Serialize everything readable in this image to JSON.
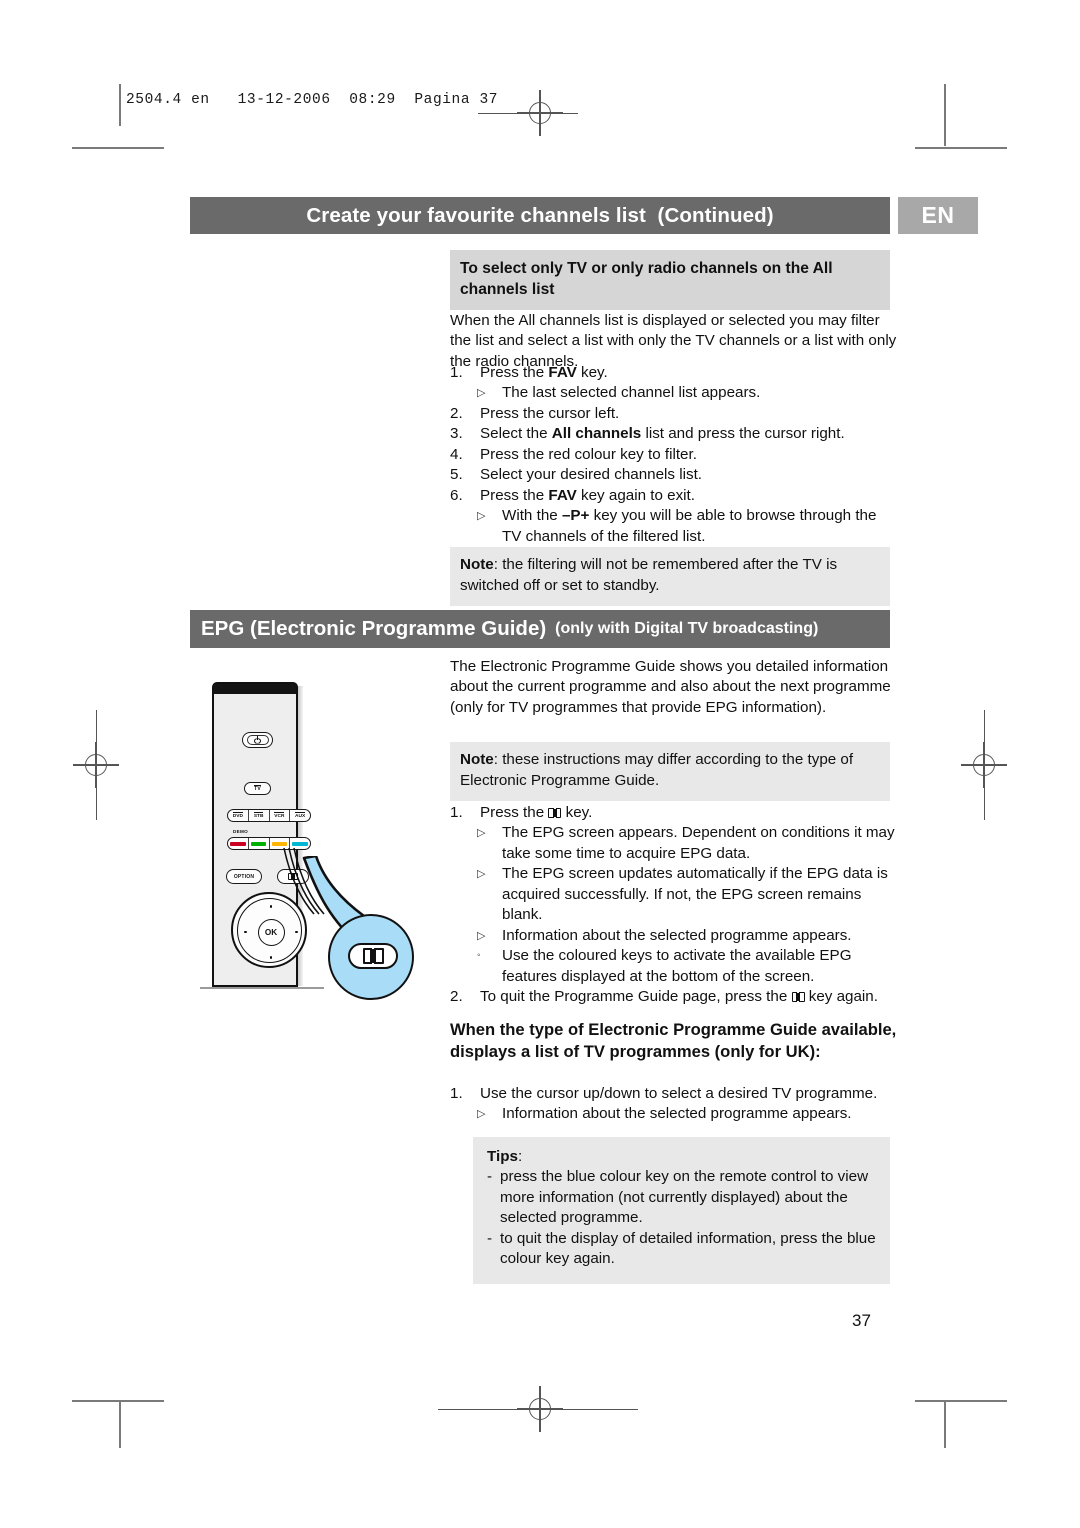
{
  "print_marks": {
    "file_info": "2504.4 en   13-12-2006  08:29  Pagina 37"
  },
  "header": {
    "title_main": "Create your favourite channels list",
    "title_continued": "(Continued)",
    "language_badge": "EN"
  },
  "section_filter": {
    "subheading": "To select only TV or only radio channels on the All channels list",
    "intro": "When the All channels list is displayed or selected you may filter the list and select a list with only the TV channels or a list with only the radio channels.",
    "steps": [
      {
        "num": "1.",
        "text_a": "Press the ",
        "bold": "FAV",
        "text_b": " key."
      },
      {
        "num": "2.",
        "text_a": "Press the cursor left.",
        "bold": "",
        "text_b": ""
      },
      {
        "num": "3.",
        "text_a": "Select the ",
        "bold": "All channels",
        "text_b": " list and press the cursor right."
      },
      {
        "num": "4.",
        "text_a": "Press the red colour key to filter.",
        "bold": "",
        "text_b": ""
      },
      {
        "num": "5.",
        "text_a": "Select your desired channels list.",
        "bold": "",
        "text_b": ""
      },
      {
        "num": "6.",
        "text_a": "Press the ",
        "bold": "FAV",
        "text_b": " key again to exit."
      }
    ],
    "sub_after_step1": "The last selected channel list appears.",
    "sub_after_step6_a": "With the ",
    "sub_after_step6_bold": "–P+",
    "sub_after_step6_b": " key you will be able to browse through the TV channels of the filtered list.",
    "note_label": "Note",
    "note_text": ": the filtering will not be remembered after the TV is switched off or set to standby."
  },
  "section_epg": {
    "bar_main": "EPG (Electronic Programme Guide)",
    "bar_small": "(only with Digital TV broadcasting)",
    "intro": "The Electronic Programme Guide shows you detailed information about the current programme and also about the next programme (only for TV programmes that provide EPG information).",
    "note_label": "Note",
    "note_text": ": these instructions may differ according to the type of Electronic Programme Guide.",
    "step1_num": "1.",
    "step1_a": "Press the ",
    "step1_b": " key.",
    "step1_subs": [
      "The EPG screen appears. Dependent on conditions it may take some time to acquire EPG data.",
      "The EPG screen updates automatically if the EPG data is acquired successfully. If not, the EPG screen remains blank.",
      "Information about the selected programme appears."
    ],
    "circle_sub": "Use the coloured keys to activate the available EPG features displayed at the bottom of the screen.",
    "step2_num": "2.",
    "step2_a": "To quit the Programme Guide page, press the ",
    "step2_b": " key again."
  },
  "section_uk": {
    "heading": "When the type of Electronic Programme Guide available, displays a list of TV programmes (only for UK):",
    "step1_num": "1.",
    "step1_text": "Use the cursor up/down to select a desired TV programme.",
    "step1_sub": "Information about the selected programme appears.",
    "tips_label": "Tips",
    "tips_colon": ":",
    "tips": [
      "press the blue colour key on the remote control to view more information (not currently displayed) about the selected programme.",
      "to quit the display of detailed information, press the blue colour key again."
    ],
    "tip_dash": "-"
  },
  "remote": {
    "power_label": "power-icon",
    "tv_label": "TV",
    "source_buttons": [
      "DVD",
      "STB",
      "VCR",
      "AUX"
    ],
    "demo_label": "DEMO",
    "colour_keys": [
      {
        "name": "red",
        "hex": "#cc0022"
      },
      {
        "name": "green",
        "hex": "#00b000"
      },
      {
        "name": "yellow",
        "hex": "#ffb400"
      },
      {
        "name": "cyan",
        "hex": "#00b8d4"
      }
    ],
    "option_label": "OPTION",
    "guide_label": "guide-book-icon",
    "ok_label": "OK",
    "callout_colour": "#a9ddf7"
  },
  "footer": {
    "page_number": "37"
  }
}
